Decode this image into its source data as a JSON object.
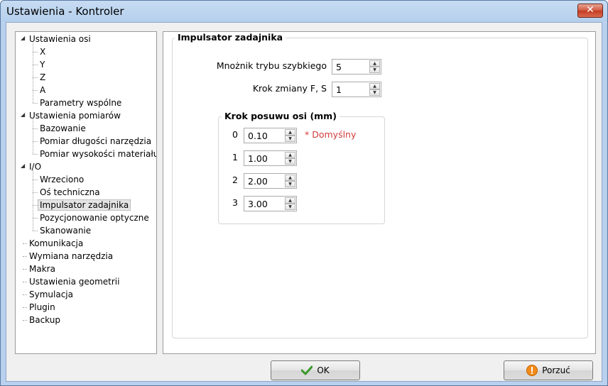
{
  "window": {
    "title": "Ustawienia - Kontroler",
    "close_glyph": "✕"
  },
  "tree": [
    {
      "label": "Ustawienia osi",
      "level": 0,
      "expanded": true
    },
    {
      "label": "X",
      "level": 1
    },
    {
      "label": "Y",
      "level": 1
    },
    {
      "label": "Z",
      "level": 1
    },
    {
      "label": "A",
      "level": 1
    },
    {
      "label": "Parametry wspólne",
      "level": 1
    },
    {
      "label": "Ustawienia pomiarów",
      "level": 0,
      "expanded": true
    },
    {
      "label": "Bazowanie",
      "level": 1
    },
    {
      "label": "Pomiar długości narzędzia",
      "level": 1
    },
    {
      "label": "Pomiar wysokości materiału",
      "level": 1
    },
    {
      "label": "I/O",
      "level": 0,
      "expanded": true
    },
    {
      "label": "Wrzeciono",
      "level": 1
    },
    {
      "label": "Oś techniczna",
      "level": 1
    },
    {
      "label": "Impulsator zadajnika",
      "level": 1,
      "selected": true
    },
    {
      "label": "Pozycjonowanie optyczne",
      "level": 1
    },
    {
      "label": "Skanowanie",
      "level": 1
    },
    {
      "label": "Komunikacja",
      "level": 0
    },
    {
      "label": "Wymiana narzędzia",
      "level": 0
    },
    {
      "label": "Makra",
      "level": 0
    },
    {
      "label": "Ustawienia geometrii",
      "level": 0
    },
    {
      "label": "Symulacja",
      "level": 0
    },
    {
      "label": "Plugin",
      "level": 0
    },
    {
      "label": "Backup",
      "level": 0
    }
  ],
  "panel": {
    "group_title": "Impulsator zadajnika",
    "multiplier_label": "Mnożnik trybu szybkiego",
    "multiplier_value": "5",
    "step_label": "Krok zmiany F, S",
    "step_value": "1",
    "feed_group_title": "Krok posuwu osi (mm)",
    "feed_steps": [
      {
        "index": "0",
        "value": "0.10"
      },
      {
        "index": "1",
        "value": "1.00"
      },
      {
        "index": "2",
        "value": "2.00"
      },
      {
        "index": "3",
        "value": "3.00"
      }
    ],
    "default_note": "* Domyślny"
  },
  "buttons": {
    "ok": "OK",
    "cancel": "Porzuć"
  },
  "colors": {
    "ok_check": "#3a9a2a",
    "cancel_icon": "#f08a1a",
    "default_note": "#d23b3b"
  }
}
